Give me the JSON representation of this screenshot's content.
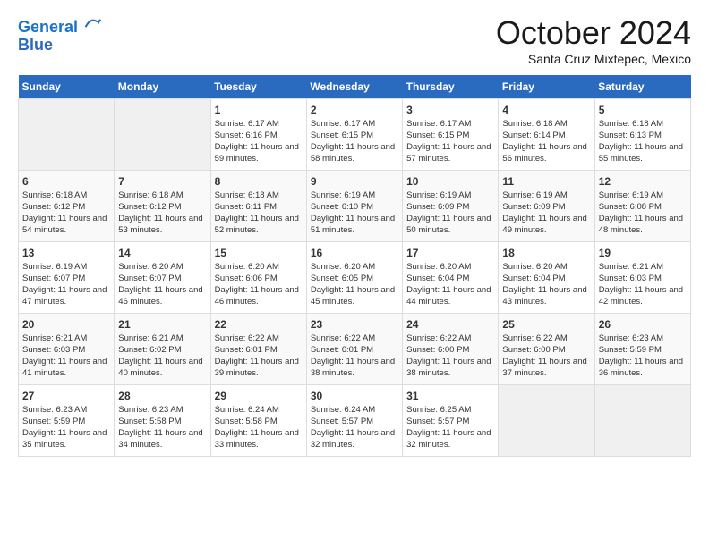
{
  "header": {
    "logo_line1": "General",
    "logo_line2": "Blue",
    "month": "October 2024",
    "location": "Santa Cruz Mixtepec, Mexico"
  },
  "days_of_week": [
    "Sunday",
    "Monday",
    "Tuesday",
    "Wednesday",
    "Thursday",
    "Friday",
    "Saturday"
  ],
  "weeks": [
    [
      {
        "num": "",
        "info": ""
      },
      {
        "num": "",
        "info": ""
      },
      {
        "num": "1",
        "info": "Sunrise: 6:17 AM\nSunset: 6:16 PM\nDaylight: 11 hours and 59 minutes."
      },
      {
        "num": "2",
        "info": "Sunrise: 6:17 AM\nSunset: 6:15 PM\nDaylight: 11 hours and 58 minutes."
      },
      {
        "num": "3",
        "info": "Sunrise: 6:17 AM\nSunset: 6:15 PM\nDaylight: 11 hours and 57 minutes."
      },
      {
        "num": "4",
        "info": "Sunrise: 6:18 AM\nSunset: 6:14 PM\nDaylight: 11 hours and 56 minutes."
      },
      {
        "num": "5",
        "info": "Sunrise: 6:18 AM\nSunset: 6:13 PM\nDaylight: 11 hours and 55 minutes."
      }
    ],
    [
      {
        "num": "6",
        "info": "Sunrise: 6:18 AM\nSunset: 6:12 PM\nDaylight: 11 hours and 54 minutes."
      },
      {
        "num": "7",
        "info": "Sunrise: 6:18 AM\nSunset: 6:12 PM\nDaylight: 11 hours and 53 minutes."
      },
      {
        "num": "8",
        "info": "Sunrise: 6:18 AM\nSunset: 6:11 PM\nDaylight: 11 hours and 52 minutes."
      },
      {
        "num": "9",
        "info": "Sunrise: 6:19 AM\nSunset: 6:10 PM\nDaylight: 11 hours and 51 minutes."
      },
      {
        "num": "10",
        "info": "Sunrise: 6:19 AM\nSunset: 6:09 PM\nDaylight: 11 hours and 50 minutes."
      },
      {
        "num": "11",
        "info": "Sunrise: 6:19 AM\nSunset: 6:09 PM\nDaylight: 11 hours and 49 minutes."
      },
      {
        "num": "12",
        "info": "Sunrise: 6:19 AM\nSunset: 6:08 PM\nDaylight: 11 hours and 48 minutes."
      }
    ],
    [
      {
        "num": "13",
        "info": "Sunrise: 6:19 AM\nSunset: 6:07 PM\nDaylight: 11 hours and 47 minutes."
      },
      {
        "num": "14",
        "info": "Sunrise: 6:20 AM\nSunset: 6:07 PM\nDaylight: 11 hours and 46 minutes."
      },
      {
        "num": "15",
        "info": "Sunrise: 6:20 AM\nSunset: 6:06 PM\nDaylight: 11 hours and 46 minutes."
      },
      {
        "num": "16",
        "info": "Sunrise: 6:20 AM\nSunset: 6:05 PM\nDaylight: 11 hours and 45 minutes."
      },
      {
        "num": "17",
        "info": "Sunrise: 6:20 AM\nSunset: 6:04 PM\nDaylight: 11 hours and 44 minutes."
      },
      {
        "num": "18",
        "info": "Sunrise: 6:20 AM\nSunset: 6:04 PM\nDaylight: 11 hours and 43 minutes."
      },
      {
        "num": "19",
        "info": "Sunrise: 6:21 AM\nSunset: 6:03 PM\nDaylight: 11 hours and 42 minutes."
      }
    ],
    [
      {
        "num": "20",
        "info": "Sunrise: 6:21 AM\nSunset: 6:03 PM\nDaylight: 11 hours and 41 minutes."
      },
      {
        "num": "21",
        "info": "Sunrise: 6:21 AM\nSunset: 6:02 PM\nDaylight: 11 hours and 40 minutes."
      },
      {
        "num": "22",
        "info": "Sunrise: 6:22 AM\nSunset: 6:01 PM\nDaylight: 11 hours and 39 minutes."
      },
      {
        "num": "23",
        "info": "Sunrise: 6:22 AM\nSunset: 6:01 PM\nDaylight: 11 hours and 38 minutes."
      },
      {
        "num": "24",
        "info": "Sunrise: 6:22 AM\nSunset: 6:00 PM\nDaylight: 11 hours and 38 minutes."
      },
      {
        "num": "25",
        "info": "Sunrise: 6:22 AM\nSunset: 6:00 PM\nDaylight: 11 hours and 37 minutes."
      },
      {
        "num": "26",
        "info": "Sunrise: 6:23 AM\nSunset: 5:59 PM\nDaylight: 11 hours and 36 minutes."
      }
    ],
    [
      {
        "num": "27",
        "info": "Sunrise: 6:23 AM\nSunset: 5:59 PM\nDaylight: 11 hours and 35 minutes."
      },
      {
        "num": "28",
        "info": "Sunrise: 6:23 AM\nSunset: 5:58 PM\nDaylight: 11 hours and 34 minutes."
      },
      {
        "num": "29",
        "info": "Sunrise: 6:24 AM\nSunset: 5:58 PM\nDaylight: 11 hours and 33 minutes."
      },
      {
        "num": "30",
        "info": "Sunrise: 6:24 AM\nSunset: 5:57 PM\nDaylight: 11 hours and 32 minutes."
      },
      {
        "num": "31",
        "info": "Sunrise: 6:25 AM\nSunset: 5:57 PM\nDaylight: 11 hours and 32 minutes."
      },
      {
        "num": "",
        "info": ""
      },
      {
        "num": "",
        "info": ""
      }
    ]
  ]
}
